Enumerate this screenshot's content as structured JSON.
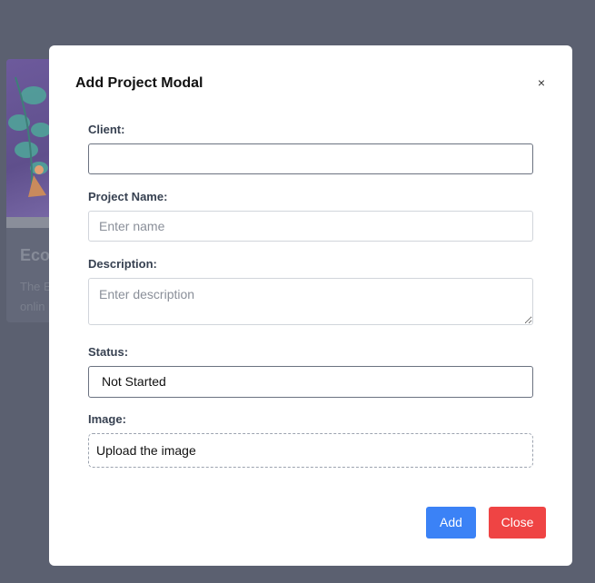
{
  "background_card": {
    "title": "Ecor",
    "text": "The E onlin"
  },
  "modal": {
    "title": "Add Project Modal",
    "close_icon": "×",
    "fields": {
      "client": {
        "label": "Client:",
        "value": "",
        "placeholder": ""
      },
      "project_name": {
        "label": "Project Name:",
        "value": "",
        "placeholder": "Enter name"
      },
      "description": {
        "label": "Description:",
        "value": "",
        "placeholder": "Enter description"
      },
      "status": {
        "label": "Status:",
        "value": "Not Started"
      },
      "image": {
        "label": "Image:",
        "upload_text": "Upload the image"
      }
    },
    "buttons": {
      "add_label": "Add",
      "close_label": "Close"
    }
  },
  "colors": {
    "overlay": "#5b6070",
    "add_button": "#3b82f6",
    "close_button": "#ef4444"
  }
}
